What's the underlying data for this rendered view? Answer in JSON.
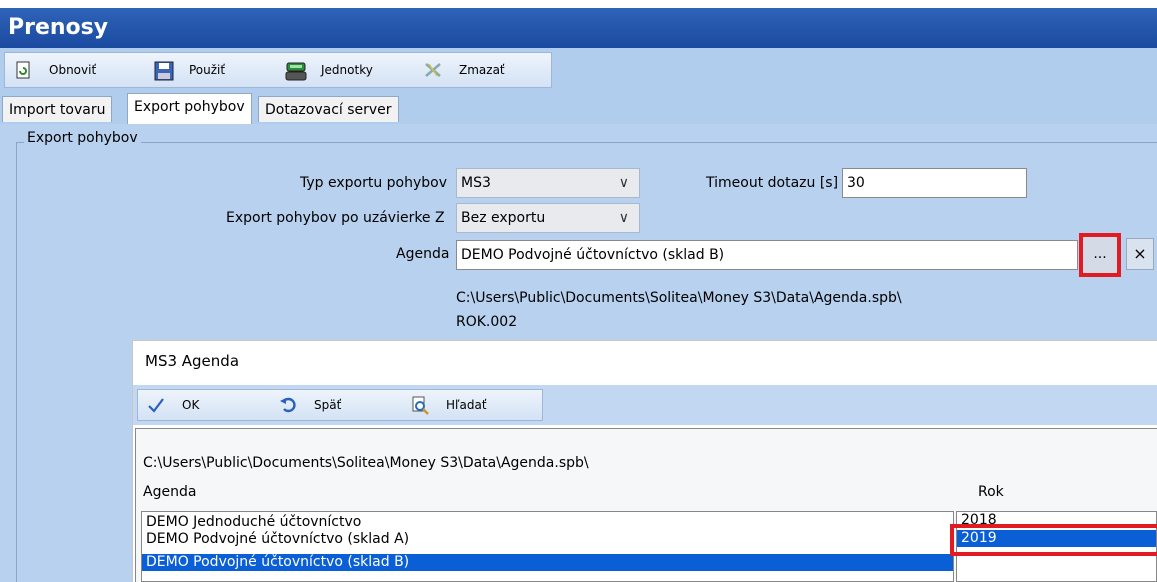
{
  "window": {
    "title": "Prenosy"
  },
  "toolbar": {
    "refresh_label": "Obnoviť",
    "apply_label": "Použiť",
    "units_label": "Jednotky",
    "delete_label": "Zmazať"
  },
  "tabs": [
    {
      "label": "Import tovaru"
    },
    {
      "label": "Export pohybov"
    },
    {
      "label": "Dotazovací server"
    }
  ],
  "group": {
    "legend": "Export pohybov"
  },
  "form": {
    "export_type_label": "Typ exportu pohybov",
    "export_type_value": "MS3",
    "timeout_label": "Timeout dotazu [s]",
    "timeout_value": "30",
    "closing_export_label": "Export pohybov po uzávierke Z",
    "closing_export_value": "Bez exportu",
    "agenda_label": "Agenda",
    "agenda_value": "DEMO Podvojné účtovníctvo (sklad B)",
    "browse_label": "...",
    "clear_label": "×",
    "path_line1": "C:\\Users\\Public\\Documents\\Solitea\\Money S3\\Data\\Agenda.spb\\",
    "path_line2": "ROK.002"
  },
  "dialog": {
    "title": "MS3 Agenda",
    "ok_label": "OK",
    "back_label": "Späť",
    "search_label": "Hľadať",
    "path": "C:\\Users\\Public\\Documents\\Solitea\\Money S3\\Data\\Agenda.spb\\",
    "col_agenda": "Agenda",
    "col_year": "Rok",
    "agendas": [
      "DEMO Jednoduché účtovníctvo",
      "DEMO Podvojné účtovníctvo (sklad A)",
      "DEMO Podvojné účtovníctvo (sklad B)"
    ],
    "years": [
      "2018",
      "2019"
    ]
  },
  "colors": {
    "accent": "#1a4aa0",
    "highlight": "#e21b23",
    "selection": "#0a5fd6"
  }
}
